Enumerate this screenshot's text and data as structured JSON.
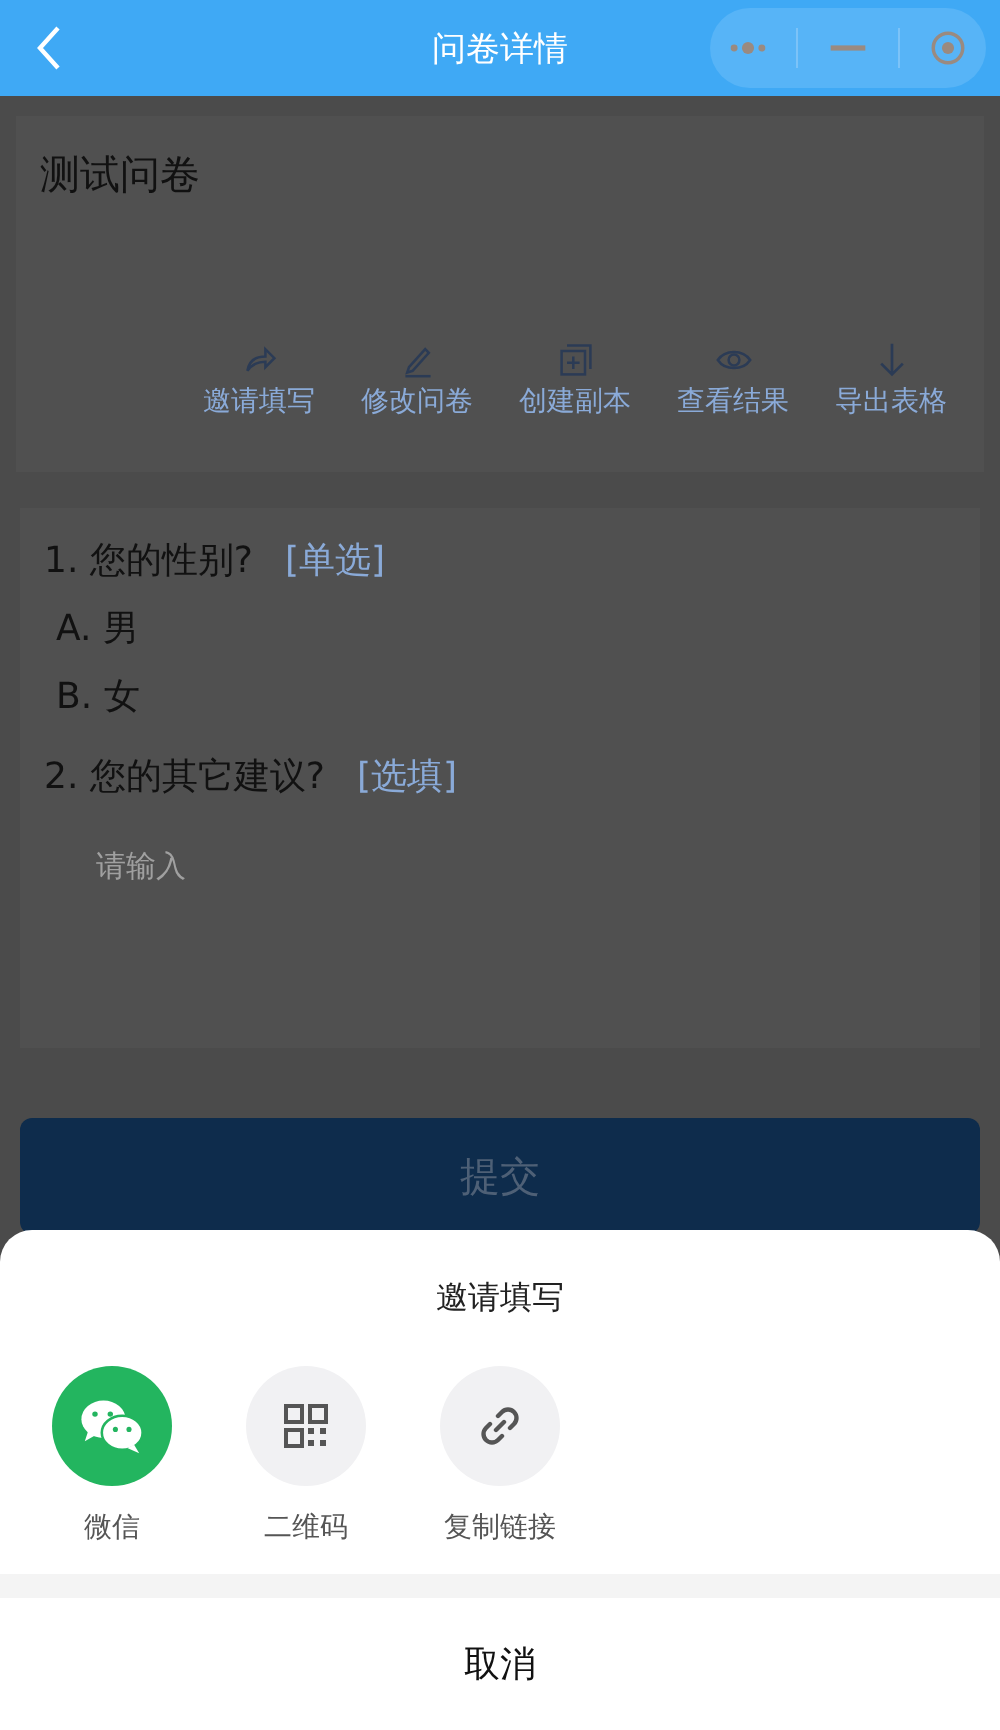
{
  "nav": {
    "title": "问卷详情"
  },
  "survey": {
    "title": "测试问卷",
    "actions": [
      {
        "kind": "share",
        "label": "邀请填写"
      },
      {
        "kind": "edit",
        "label": "修改问卷"
      },
      {
        "kind": "copy",
        "label": "创建副本"
      },
      {
        "kind": "view",
        "label": "查看结果"
      },
      {
        "kind": "export",
        "label": "导出表格"
      }
    ]
  },
  "questions": [
    {
      "kind": "choice",
      "text": "1. 您的性别?",
      "tag": "[单选]",
      "options": [
        "A. 男",
        "B. 女"
      ]
    },
    {
      "kind": "text",
      "text": "2. 您的其它建议?",
      "tag": "[选填]",
      "placeholder": "请输入"
    }
  ],
  "submit": "提交",
  "sheet": {
    "title": "邀请填写",
    "options": [
      {
        "kind": "wechat",
        "label": "微信"
      },
      {
        "kind": "qrcode",
        "label": "二维码"
      },
      {
        "kind": "link",
        "label": "复制链接"
      }
    ],
    "cancel": "取消"
  }
}
